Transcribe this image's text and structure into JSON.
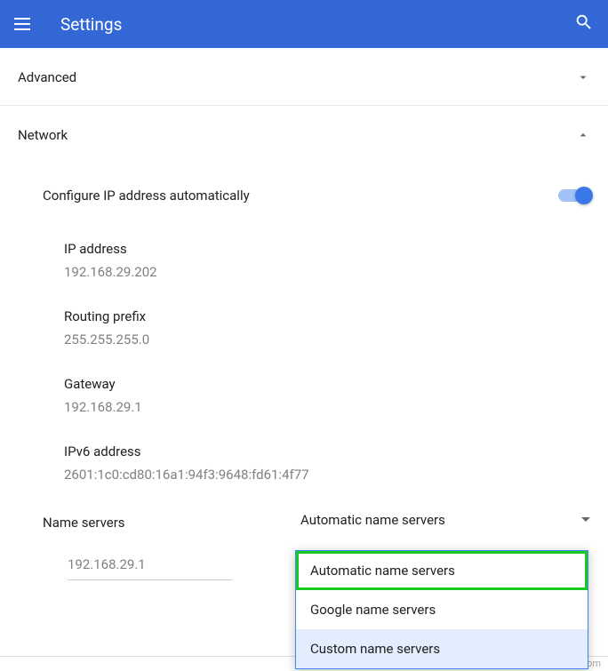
{
  "header": {
    "title": "Settings"
  },
  "sections": {
    "advanced": {
      "title": "Advanced"
    },
    "network": {
      "title": "Network"
    }
  },
  "toggle": {
    "label": "Configure IP address automatically"
  },
  "fields": {
    "ip_address": {
      "label": "IP address",
      "value": "192.168.29.202"
    },
    "routing_prefix": {
      "label": "Routing prefix",
      "value": "255.255.255.0"
    },
    "gateway": {
      "label": "Gateway",
      "value": "192.168.29.1"
    },
    "ipv6": {
      "label": "IPv6 address",
      "value": "2601:1c0:cd80:16a1:94f3:9648:fd61:4f77"
    }
  },
  "name_servers": {
    "label": "Name servers",
    "selected": "Automatic name servers",
    "input_value": "192.168.29.1",
    "options": {
      "auto": "Automatic name servers",
      "google": "Google name servers",
      "custom": "Custom name servers"
    }
  },
  "watermark": "wsxdn.com"
}
